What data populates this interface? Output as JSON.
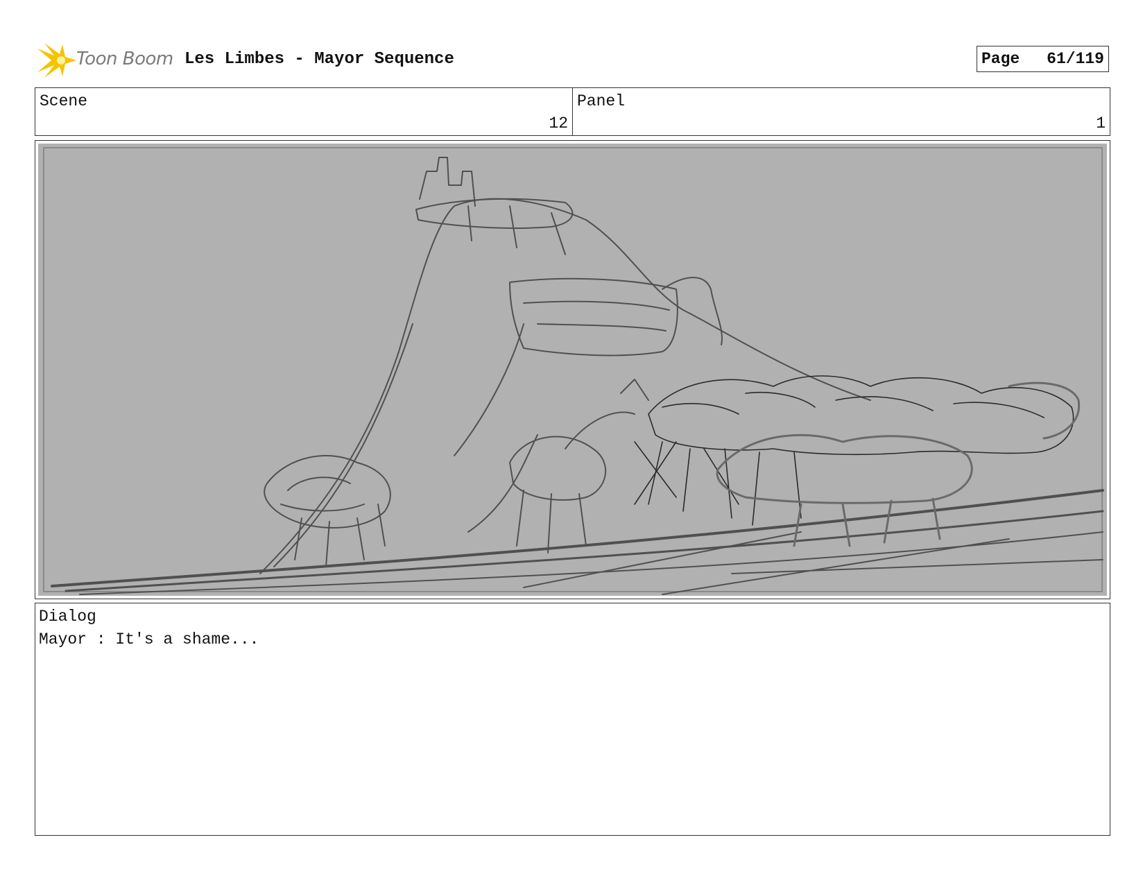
{
  "header": {
    "logo_text": "Toon Boom",
    "title": "Les Limbes - Mayor Sequence",
    "page_label": "Page",
    "page_value": "61/119"
  },
  "info": {
    "scene_label": "Scene",
    "scene_value": "12",
    "panel_label": "Panel",
    "panel_value": "1"
  },
  "panel": {
    "background_color": "#b1b1b1",
    "sketch_color": "#505050"
  },
  "dialog": {
    "label": "Dialog",
    "lines": [
      "Mayor : It's a shame..."
    ]
  },
  "colors": {
    "logo_yellow": "#f5c400",
    "logo_text_gray": "#7a7a7a",
    "border": "#333333"
  }
}
